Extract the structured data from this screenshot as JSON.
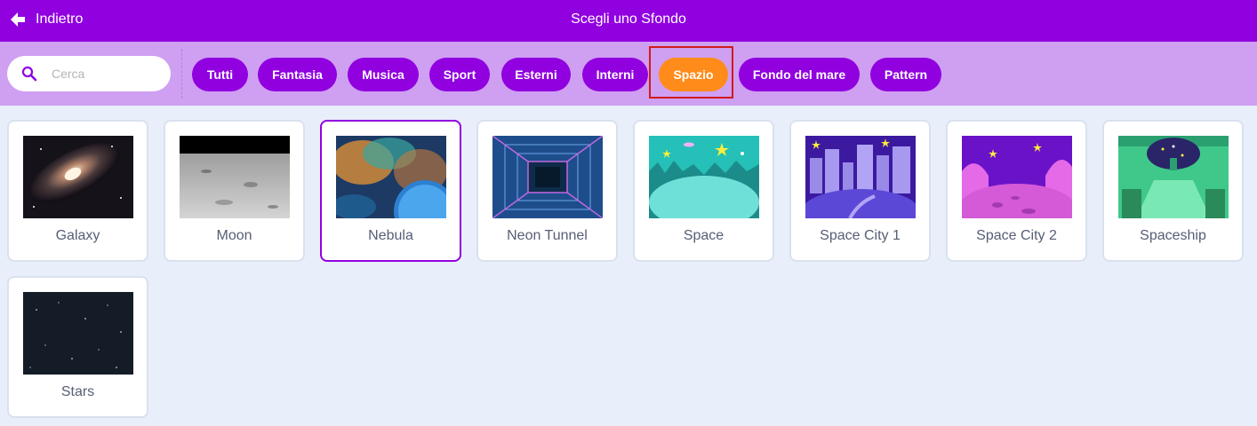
{
  "header": {
    "back_label": "Indietro",
    "title": "Scegli uno Sfondo"
  },
  "search": {
    "placeholder": "Cerca",
    "value": ""
  },
  "tags": [
    {
      "label": "Tutti",
      "active": false
    },
    {
      "label": "Fantasia",
      "active": false
    },
    {
      "label": "Musica",
      "active": false
    },
    {
      "label": "Sport",
      "active": false
    },
    {
      "label": "Esterni",
      "active": false
    },
    {
      "label": "Interni",
      "active": false
    },
    {
      "label": "Spazio",
      "active": true
    },
    {
      "label": "Fondo del mare",
      "active": false
    },
    {
      "label": "Pattern",
      "active": false
    }
  ],
  "backdrops": [
    {
      "name": "Galaxy",
      "selected": false,
      "icon": "galaxy-thumbnail"
    },
    {
      "name": "Moon",
      "selected": false,
      "icon": "moon-thumbnail"
    },
    {
      "name": "Nebula",
      "selected": true,
      "icon": "nebula-thumbnail"
    },
    {
      "name": "Neon Tunnel",
      "selected": false,
      "icon": "neon-tunnel-thumbnail"
    },
    {
      "name": "Space",
      "selected": false,
      "icon": "space-thumbnail"
    },
    {
      "name": "Space City 1",
      "selected": false,
      "icon": "space-city-1-thumbnail"
    },
    {
      "name": "Space City 2",
      "selected": false,
      "icon": "space-city-2-thumbnail"
    },
    {
      "name": "Spaceship",
      "selected": false,
      "icon": "spaceship-thumbnail"
    },
    {
      "name": "Stars",
      "selected": false,
      "icon": "stars-thumbnail"
    }
  ],
  "colors": {
    "header_bg": "#9101e0",
    "filterbar_bg": "#cf9ff2",
    "tag_bg": "#9101e0",
    "tag_active_bg": "#ff8c1a",
    "highlight_border": "#d11a1a",
    "page_bg": "#e9effa"
  }
}
